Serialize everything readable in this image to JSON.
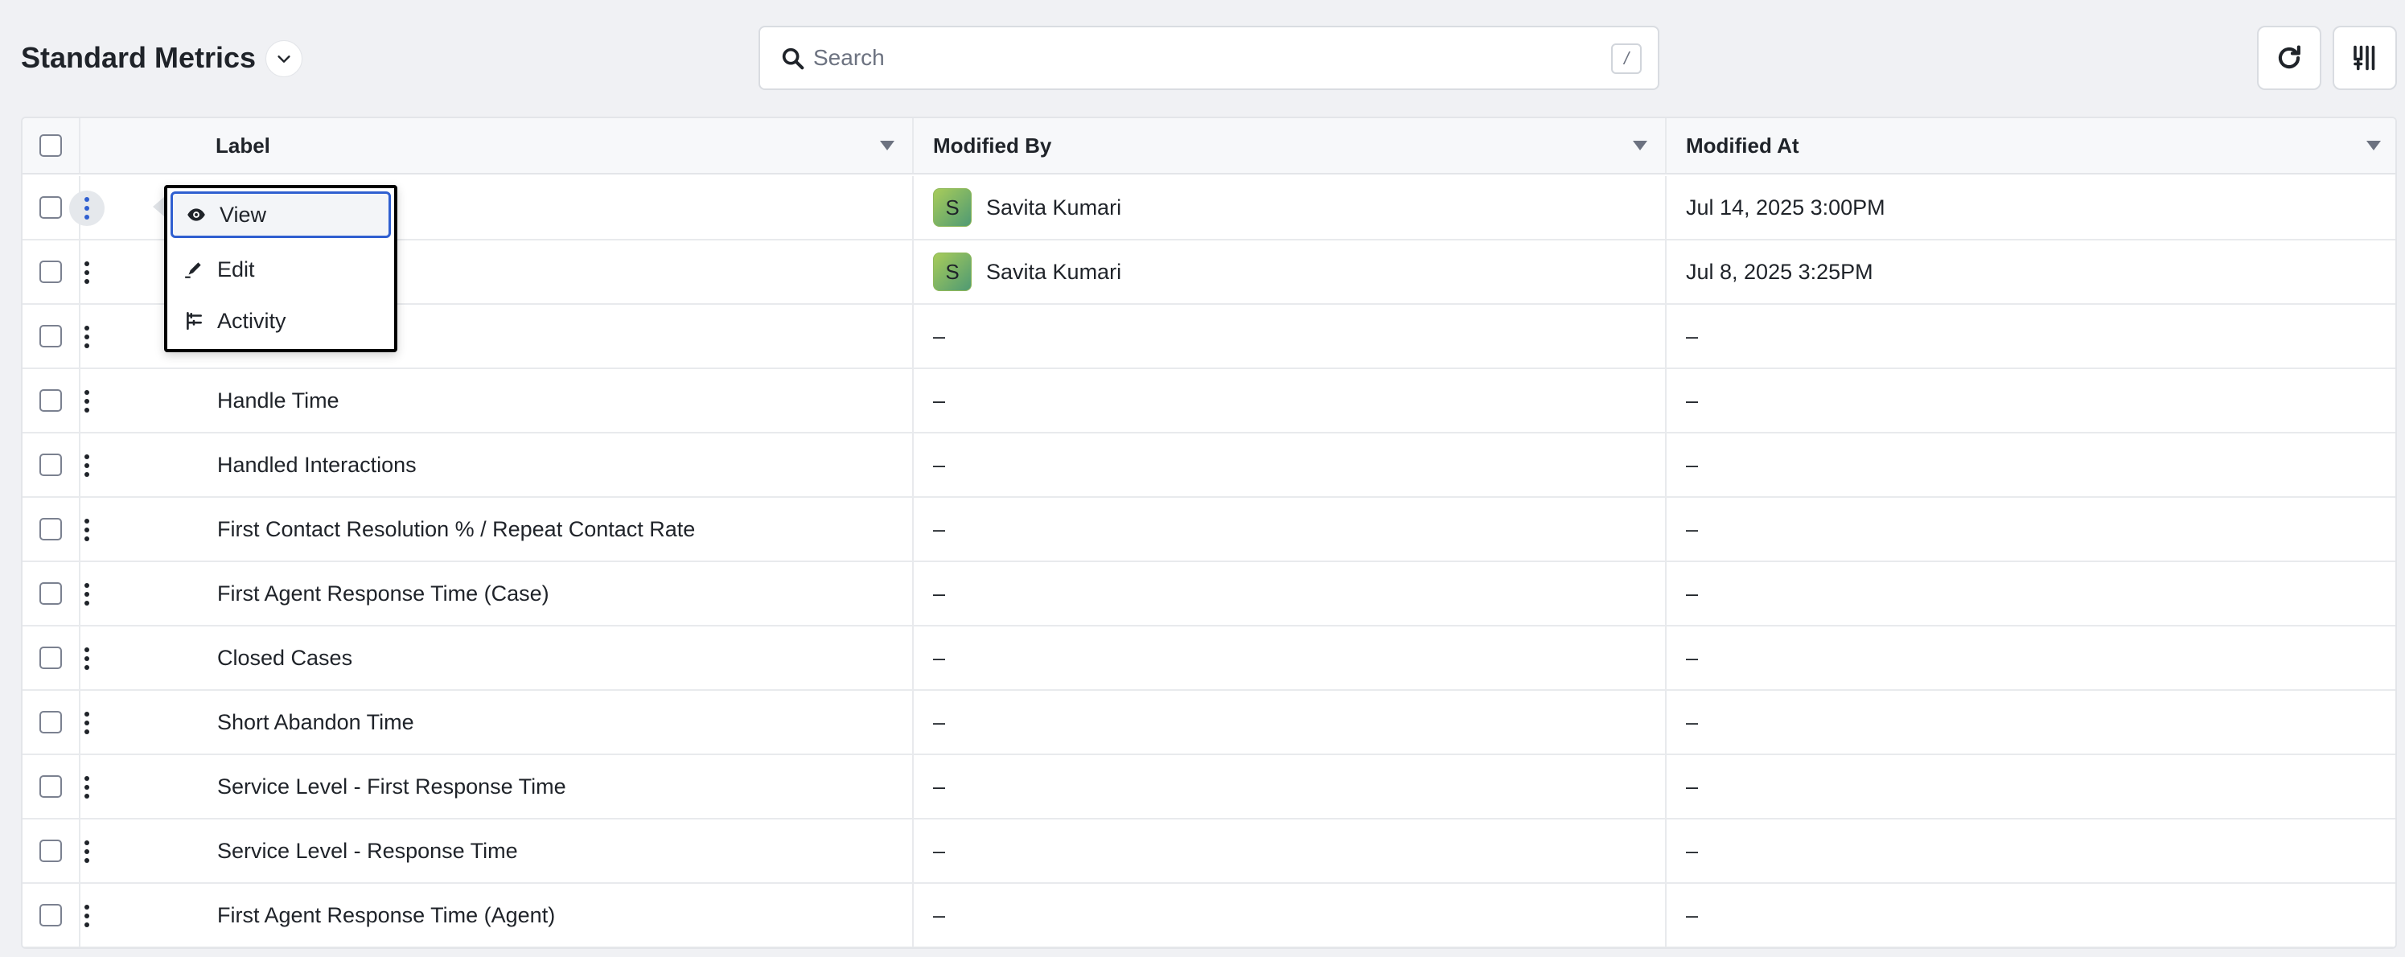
{
  "header": {
    "title": "Standard Metrics",
    "search_placeholder": "Search",
    "search_shortcut": "/"
  },
  "table": {
    "columns": [
      "Label",
      "Modified By",
      "Modified At"
    ],
    "rows": [
      {
        "label": "",
        "modified_by": "Savita Kumari",
        "avatar": "S",
        "modified_at": "Jul 14, 2025 3:00PM"
      },
      {
        "label": "",
        "modified_by": "Savita Kumari",
        "avatar": "S",
        "modified_at": "Jul 8, 2025 3:25PM"
      },
      {
        "label": "",
        "modified_by": "–",
        "modified_at": "–"
      },
      {
        "label": "Handle Time",
        "modified_by": "–",
        "modified_at": "–"
      },
      {
        "label": "Handled Interactions",
        "modified_by": "–",
        "modified_at": "–"
      },
      {
        "label": "First Contact Resolution % / Repeat Contact Rate",
        "modified_by": "–",
        "modified_at": "–"
      },
      {
        "label": "First Agent Response Time (Case)",
        "modified_by": "–",
        "modified_at": "–"
      },
      {
        "label": "Closed Cases",
        "modified_by": "–",
        "modified_at": "–"
      },
      {
        "label": "Short Abandon Time",
        "modified_by": "–",
        "modified_at": "–"
      },
      {
        "label": "Service Level - First Response Time",
        "modified_by": "–",
        "modified_at": "–"
      },
      {
        "label": "Service Level - Response Time",
        "modified_by": "–",
        "modified_at": "–"
      },
      {
        "label": "First Agent Response Time (Agent)",
        "modified_by": "–",
        "modified_at": "–"
      }
    ]
  },
  "context_menu": {
    "items": [
      "View",
      "Edit",
      "Activity"
    ]
  },
  "colors": {
    "accent": "#2f5fd0",
    "avatar_start": "#a8cc5a",
    "avatar_end": "#4f9a73"
  }
}
